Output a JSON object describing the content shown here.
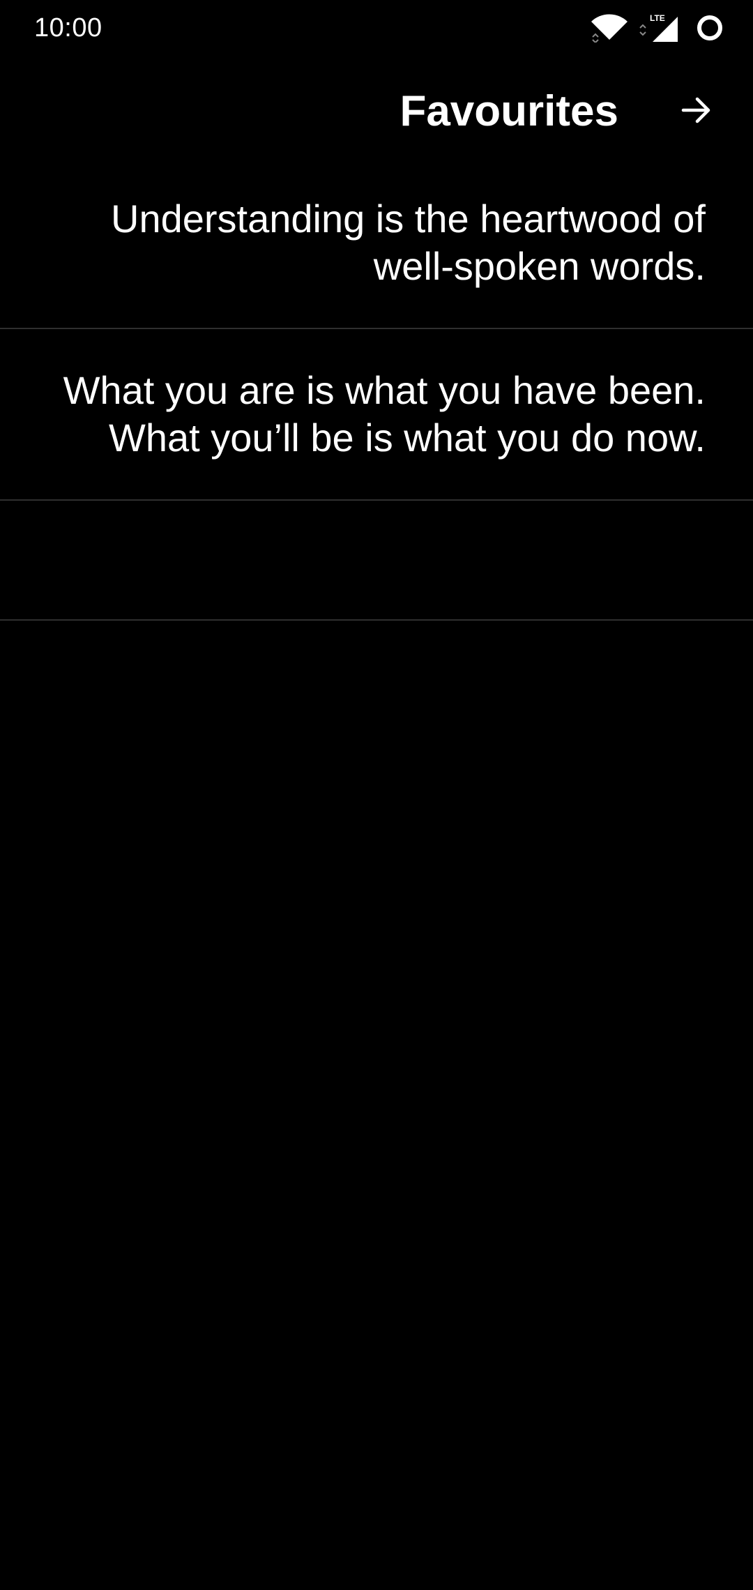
{
  "status_bar": {
    "time": "10:00",
    "network": "LTE",
    "icons": [
      "wifi-icon",
      "lte-signal-icon",
      "circle-icon"
    ]
  },
  "header": {
    "title": "Favourites",
    "forward_icon": "arrow-right-icon"
  },
  "favourites": [
    {
      "text": "Understanding is the heartwood of\nwell-spoken words."
    },
    {
      "text": "What you are is what you have been.\nWhat you’ll be is what you do now."
    },
    {
      "text": ""
    }
  ],
  "colors": {
    "background": "#000000",
    "text": "#ffffff",
    "divider": "#2f2f2f"
  }
}
